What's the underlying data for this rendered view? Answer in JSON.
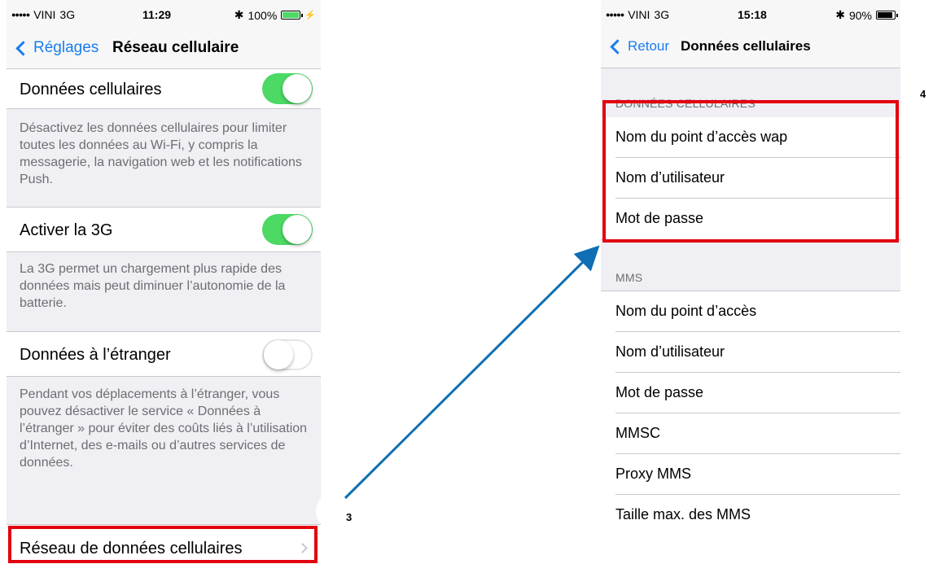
{
  "left_screen": {
    "status": {
      "carrier": "VINI",
      "network": "3G",
      "time": "11:29",
      "battery": "100%",
      "battery_fill": 1.0
    },
    "nav": {
      "back_label": "Réglages",
      "title": "Réseau cellulaire"
    },
    "cellular_data": {
      "label": "Données cellulaires",
      "enabled": true,
      "description": "Désactivez les données cellulaires pour limiter toutes les données au Wi-Fi, y compris la messagerie, la navigation web et les notifications Push."
    },
    "enable_3g": {
      "label": "Activer la 3G",
      "enabled": true,
      "description": "La 3G permet un chargement plus rapide des données mais peut diminuer l’autonomie de la batterie."
    },
    "roaming": {
      "label": "Données à l’étranger",
      "enabled": false,
      "description": "Pendant vos déplacements à l’étranger, vous pouvez désactiver le service « Données à l’étranger » pour éviter des coûts liés à l’utilisation d’Internet, des e-mails ou d’autres services de données."
    },
    "cellular_network": {
      "label": "Réseau de données cellulaires"
    }
  },
  "right_screen": {
    "status": {
      "carrier": "VINI",
      "network": "3G",
      "time": "15:18",
      "battery": "90%",
      "battery_fill": 0.9
    },
    "nav": {
      "back_label": "Retour",
      "title": "Données cellulaires"
    },
    "cellular_section": {
      "header": "DONNÉES CELLULAIRES",
      "rows": [
        {
          "label": "Nom du point d’accès  wap"
        },
        {
          "label": "Nom d’utilisateur"
        },
        {
          "label": "Mot de passe"
        }
      ]
    },
    "mms_section": {
      "header": "MMS",
      "rows": [
        {
          "label": "Nom du point d’accès"
        },
        {
          "label": "Nom d’utilisateur"
        },
        {
          "label": "Mot de passe"
        },
        {
          "label": "MMSC"
        },
        {
          "label": "Proxy MMS"
        },
        {
          "label": "Taille max. des MMS"
        }
      ]
    }
  },
  "annotations": {
    "step_3": "3",
    "step_4": "4"
  },
  "colors": {
    "accent": "#1a7df0",
    "toggle_on": "#4cd964",
    "highlight": "#e3000f",
    "arrow": "#0f6eb4",
    "group_bg": "#efeff4"
  }
}
